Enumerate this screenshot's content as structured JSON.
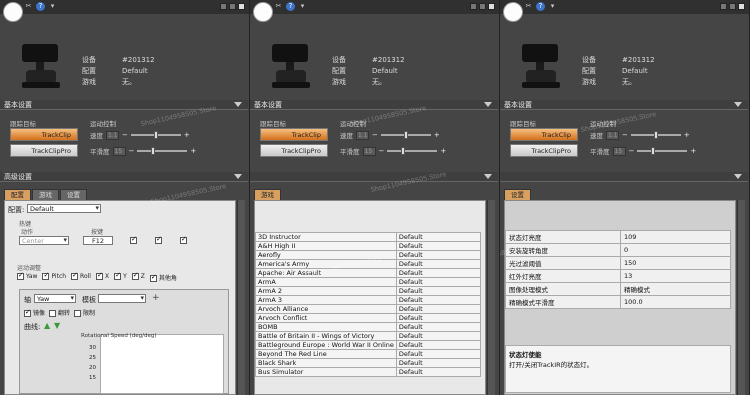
{
  "device": {
    "label_device": "设备",
    "label_profile": "配置",
    "label_game": "游戏",
    "device_value": "#201312",
    "profile_value": "Default",
    "game_value": "无。"
  },
  "sections": {
    "basic": "基本设置",
    "advanced": "高级设置"
  },
  "tracking": {
    "group_label": "跟踪目标",
    "btn_trackclip": "TrackClip",
    "btn_trackclippro": "TrackClipPro"
  },
  "motion": {
    "group_label": "运动控制",
    "speed_label": "速度",
    "speed_value": "1.1",
    "smooth_label": "平滑度",
    "smooth_value": "15"
  },
  "tabs": [
    "配置",
    "游戏",
    "设置"
  ],
  "profile_tab": {
    "profile_label": "配置:",
    "profile_value": "Default",
    "hotkey_label": "热键",
    "action_label": "动作",
    "key_label": "按键",
    "hotkey_action": "Center",
    "hotkey_key": "F12",
    "motion_adjust_label": "运动调整",
    "axes": [
      "Yaw",
      "Pitch",
      "Roll",
      "X",
      "Y",
      "Z",
      "其他角"
    ],
    "axis_label": "轴",
    "axis_value": "Yaw",
    "template_label": "模板",
    "mirror_label": "镜像",
    "invert_label": "翻转",
    "limit_label": "限制",
    "curve_label": "曲线:",
    "curve_title": "Rotational Speed (deg/deg)",
    "curve_ticks": [
      "30",
      "25",
      "20",
      "15"
    ]
  },
  "games_tab": {
    "header": "游戏",
    "rows": [
      [
        "3D Instructor",
        "Default"
      ],
      [
        "A&H High II",
        "Default"
      ],
      [
        "Aerofly",
        "Default"
      ],
      [
        "America's Army",
        "Default"
      ],
      [
        "Apache: Air Assault",
        "Default"
      ],
      [
        "ArmA",
        "Default"
      ],
      [
        "ArmA 2",
        "Default"
      ],
      [
        "ArmA 3",
        "Default"
      ],
      [
        "Arvoch Alliance",
        "Default"
      ],
      [
        "Arvoch Conflict",
        "Default"
      ],
      [
        "BOMB",
        "Default"
      ],
      [
        "Battle of Britain II - Wings of Victory",
        "Default"
      ],
      [
        "Battleground Europe : World War II Online",
        "Default"
      ],
      [
        "Beyond The Red Line",
        "Default"
      ],
      [
        "Black Shark",
        "Default"
      ],
      [
        "Bus Simulator",
        "Default"
      ]
    ]
  },
  "settings_tab": {
    "header": "设置",
    "rows": [
      [
        "状态灯亮度",
        "109"
      ],
      [
        "安装旋转角度",
        "0"
      ],
      [
        "光过滤阈值",
        "150"
      ],
      [
        "红外灯亮度",
        "13"
      ],
      [
        "图像处理模式",
        "精确模式"
      ],
      [
        "精确模式平滑度",
        "100.0"
      ]
    ],
    "desc_title": "状态灯使能",
    "desc_text": "打开/关闭TrackIR的状态灯。"
  },
  "watermark": "Shop1104958505.Store"
}
